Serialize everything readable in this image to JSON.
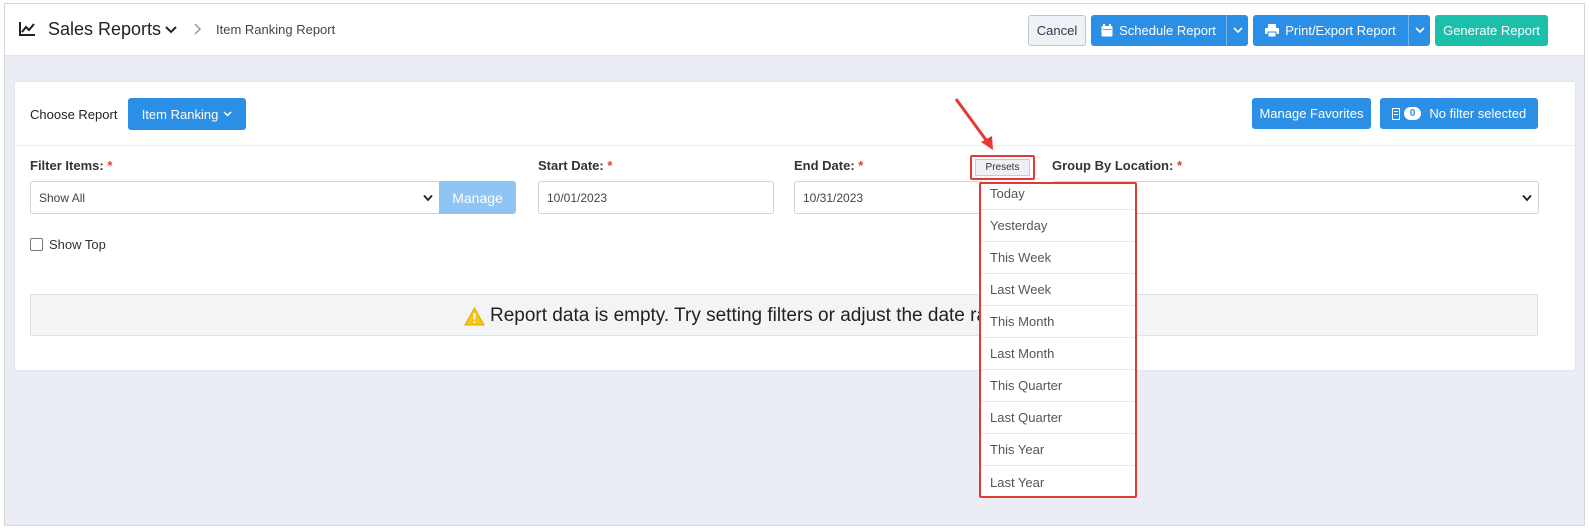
{
  "header": {
    "app_title": "Sales Reports",
    "breadcrumb": "Item Ranking Report",
    "cancel_label": "Cancel",
    "schedule_label": "Schedule Report",
    "print_label": "Print/Export Report",
    "generate_label": "Generate Report",
    "icons": [
      "line-chart-icon",
      "chevron-down-icon",
      "chevron-right-icon",
      "calendar-icon",
      "printer-icon"
    ]
  },
  "report_bar": {
    "choose_label": "Choose Report",
    "report_button": "Item Ranking",
    "favorites_label": "Manage Favorites",
    "filter_count": "0",
    "filter_label": "No filter selected"
  },
  "filters": {
    "filter_items": {
      "label": "Filter Items:",
      "required_mark": "*",
      "value": "Show All",
      "manage_label": "Manage"
    },
    "start_date": {
      "label": "Start Date:",
      "required_mark": "*",
      "value": "10/01/2023"
    },
    "end_date": {
      "label": "End Date:",
      "required_mark": "*",
      "value": "10/31/2023"
    },
    "presets_label": "Presets",
    "group_by": {
      "label": "Group By Location:",
      "required_mark": "*",
      "value": ""
    },
    "show_top_label": "Show Top",
    "show_top_checked": false
  },
  "empty_message": "Report data is empty. Try setting filters or adjust the date ra",
  "presets_menu": [
    "Today",
    "Yesterday",
    "This Week",
    "Last Week",
    "This Month",
    "Last Month",
    "This Quarter",
    "Last Quarter",
    "This Year",
    "Last Year"
  ],
  "colors": {
    "primary": "#2c8fe6",
    "success": "#1cbfaa",
    "highlight": "#e53935",
    "warning": "#f5c518",
    "page_background": "#ebedf5"
  }
}
